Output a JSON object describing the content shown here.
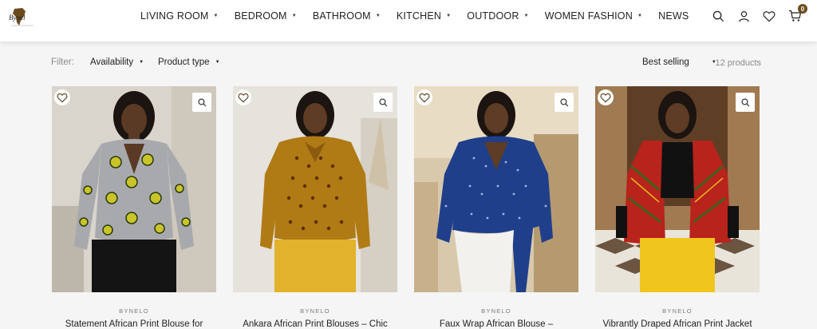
{
  "header": {
    "logo_text": "BYNELO",
    "nav": [
      {
        "label": "LIVING ROOM",
        "caret": true
      },
      {
        "label": "BEDROOM",
        "caret": true
      },
      {
        "label": "BATHROOM",
        "caret": true
      },
      {
        "label": "KITCHEN",
        "caret": true
      },
      {
        "label": "OUTDOOR",
        "caret": true
      },
      {
        "label": "WOMEN FASHION",
        "caret": true
      },
      {
        "label": "NEWS",
        "caret": false
      }
    ],
    "cart_count": "0"
  },
  "filters": {
    "label": "Filter:",
    "availability": "Availability",
    "product_type": "Product type",
    "sort": "Best selling",
    "count": "12 products"
  },
  "products": [
    {
      "brand": "BYNELO",
      "title": "Statement African Print Blouse for"
    },
    {
      "brand": "BYNELO",
      "title": "Ankara African Print Blouses – Chic"
    },
    {
      "brand": "BYNELO",
      "title": "Faux Wrap African Blouse –"
    },
    {
      "brand": "BYNELO",
      "title": "Vibrantly Draped African Print Jacket"
    }
  ],
  "colors": {
    "accent": "#6b4a1e"
  }
}
